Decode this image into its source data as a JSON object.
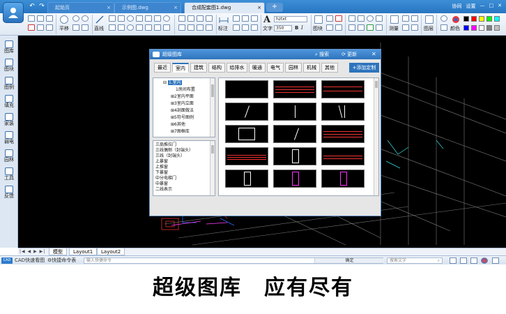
{
  "tabs": {
    "documents": [
      {
        "label": "起始页",
        "active": false
      },
      {
        "label": "示例图.dwg",
        "active": false
      },
      {
        "label": "合成配套图1.dwg",
        "active": true
      }
    ],
    "add_label": "+"
  },
  "window": {
    "help": "协同",
    "settings": "设置"
  },
  "ribbon": {
    "pan": "平移",
    "line": "直线",
    "dim": "标注",
    "text": "文字",
    "text_style": "hztxt",
    "text_size": "350",
    "bold": "B",
    "italic": "I",
    "draw": "图块",
    "measure": "测量",
    "layer": "图层",
    "color": "颜色",
    "palette": [
      "#000000",
      "#ff0000",
      "#ffff00",
      "#00ff00",
      "#00ffff",
      "#0000ff",
      "#ff00ff",
      "#ffffff",
      "#808080",
      "#c0c0c0"
    ],
    "icons": [
      "new-icon",
      "open-icon",
      "save-icon",
      "print-icon",
      "undo-icon",
      "redo-icon",
      "zoom-icon",
      "line-icon",
      "circle-icon",
      "arc-icon",
      "dimension-icon",
      "text-icon",
      "block-icon",
      "measure-icon",
      "layer-icon",
      "color-icon"
    ]
  },
  "left_tools": [
    {
      "label": "图库",
      "icon": "library-icon"
    },
    {
      "label": "图块",
      "icon": "block-icon"
    },
    {
      "label": "图例",
      "icon": "legend-icon"
    },
    {
      "label": "填充",
      "icon": "hatch-icon"
    },
    {
      "label": "家装",
      "icon": "home-icon"
    },
    {
      "label": "弱电",
      "icon": "weak-current-icon"
    },
    {
      "label": "园林",
      "icon": "garden-icon"
    },
    {
      "label": "工具",
      "icon": "tool-icon"
    },
    {
      "label": "反馈",
      "icon": "feedback-icon"
    }
  ],
  "layout_tabs": {
    "nav": "|◀ ◀ ▶ ▶|",
    "items": [
      "模型",
      "Layout1",
      "Layout2"
    ]
  },
  "status": {
    "app_label": "CAD快速看图",
    "shortcut_label": "快捷命令表",
    "input_placeholder": "输入快捷命令",
    "confirm": "确定",
    "search_placeholder": "搜索文字"
  },
  "dialog": {
    "title": "超级图库",
    "search": "搜索",
    "update": "更新",
    "close": "✕",
    "categories": [
      "最近",
      "室内",
      "建筑",
      "结构",
      "给排水",
      "暖通",
      "电气",
      "园林",
      "机械",
      "其他"
    ],
    "active_category": "室内",
    "add_custom": "+添加定制",
    "tree": [
      {
        "label": "1.室内",
        "level": 0,
        "selected": true,
        "prefix": "⊟"
      },
      {
        "label": "1房间布置",
        "level": 1,
        "selected": false,
        "prefix": ""
      },
      {
        "label": "2室内平面",
        "level": 1,
        "selected": false,
        "prefix": "⊞"
      },
      {
        "label": "3室内立面",
        "level": 1,
        "selected": false,
        "prefix": "⊞"
      },
      {
        "label": "4剖面做法",
        "level": 1,
        "selected": false,
        "prefix": "⊞"
      },
      {
        "label": "5符号图例",
        "level": 1,
        "selected": false,
        "prefix": "⊞"
      },
      {
        "label": "6其他",
        "level": 1,
        "selected": false,
        "prefix": "⊞"
      },
      {
        "label": "7图框库",
        "level": 1,
        "selected": false,
        "prefix": "⊞"
      }
    ],
    "list": [
      "三扇推拉门",
      "三线偶侧（封端头）",
      "三线（封端头）",
      "上暴窗",
      "上推窗",
      "下暴窗",
      "中分电梯门",
      "中暴窗",
      "二线表示"
    ]
  },
  "caption": "超级图库　应有尽有"
}
